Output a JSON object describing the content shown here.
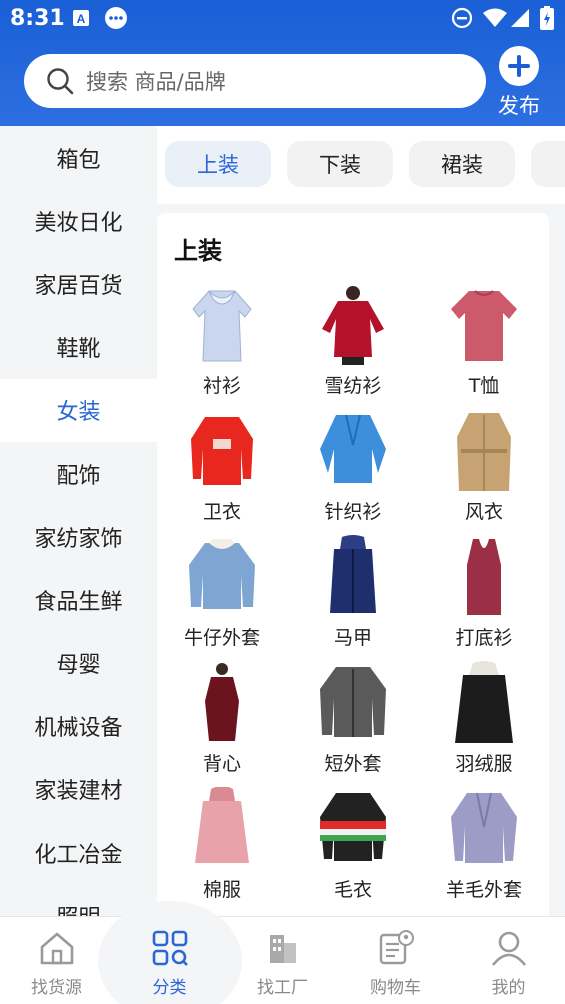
{
  "status_bar": {
    "time": "8:31"
  },
  "search": {
    "placeholder": "搜索 商品/品牌"
  },
  "publish": {
    "label": "发布"
  },
  "sidebar": {
    "items": [
      {
        "label": "箱包"
      },
      {
        "label": "美妆日化"
      },
      {
        "label": "家居百货"
      },
      {
        "label": "鞋靴"
      },
      {
        "label": "女装",
        "active": true
      },
      {
        "label": "配饰"
      },
      {
        "label": "家纺家饰"
      },
      {
        "label": "食品生鲜"
      },
      {
        "label": "母婴"
      },
      {
        "label": "机械设备"
      },
      {
        "label": "家装建材"
      },
      {
        "label": "化工冶金"
      },
      {
        "label": "照明"
      }
    ]
  },
  "tabs": [
    {
      "label": "上装",
      "active": true
    },
    {
      "label": "下装"
    },
    {
      "label": "裙装"
    },
    {
      "label": ""
    }
  ],
  "panel": {
    "title": "上装",
    "items": [
      {
        "label": "衬衫",
        "icon": "shirt-image",
        "color": "#c9d6ee"
      },
      {
        "label": "雪纺衫",
        "icon": "chiffon-blouse-image",
        "color": "#b3122a"
      },
      {
        "label": "T恤",
        "icon": "tshirt-image",
        "color": "#cc5a6a"
      },
      {
        "label": "卫衣",
        "icon": "sweatshirt-image",
        "color": "#e8281f"
      },
      {
        "label": "针织衫",
        "icon": "cardigan-image",
        "color": "#3d8fdc"
      },
      {
        "label": "风衣",
        "icon": "trench-coat-image",
        "color": "#c7a374"
      },
      {
        "label": "牛仔外套",
        "icon": "denim-jacket-image",
        "color": "#7fa6d2"
      },
      {
        "label": "马甲",
        "icon": "vest-image",
        "color": "#1f2f6e"
      },
      {
        "label": "打底衫",
        "icon": "tank-top-image",
        "color": "#9b2f45"
      },
      {
        "label": "背心",
        "icon": "camisole-image",
        "color": "#6b1420"
      },
      {
        "label": "短外套",
        "icon": "short-jacket-image",
        "color": "#5a5a5a"
      },
      {
        "label": "羽绒服",
        "icon": "down-jacket-image",
        "color": "#1c1c1c"
      },
      {
        "label": "棉服",
        "icon": "padded-coat-image",
        "color": "#e8a3aa"
      },
      {
        "label": "毛衣",
        "icon": "sweater-image",
        "color": "#222222"
      },
      {
        "label": "羊毛外套",
        "icon": "wool-coat-image",
        "color": "#9d9cc7"
      }
    ]
  },
  "bottom_nav": [
    {
      "label": "找货源",
      "icon": "home-icon"
    },
    {
      "label": "分类",
      "icon": "category-icon",
      "active": true
    },
    {
      "label": "找工厂",
      "icon": "factory-icon"
    },
    {
      "label": "购物车",
      "icon": "cart-icon"
    },
    {
      "label": "我的",
      "icon": "profile-icon"
    }
  ],
  "colors": {
    "accent": "#2a66d4",
    "header": "#1a5fd6"
  }
}
